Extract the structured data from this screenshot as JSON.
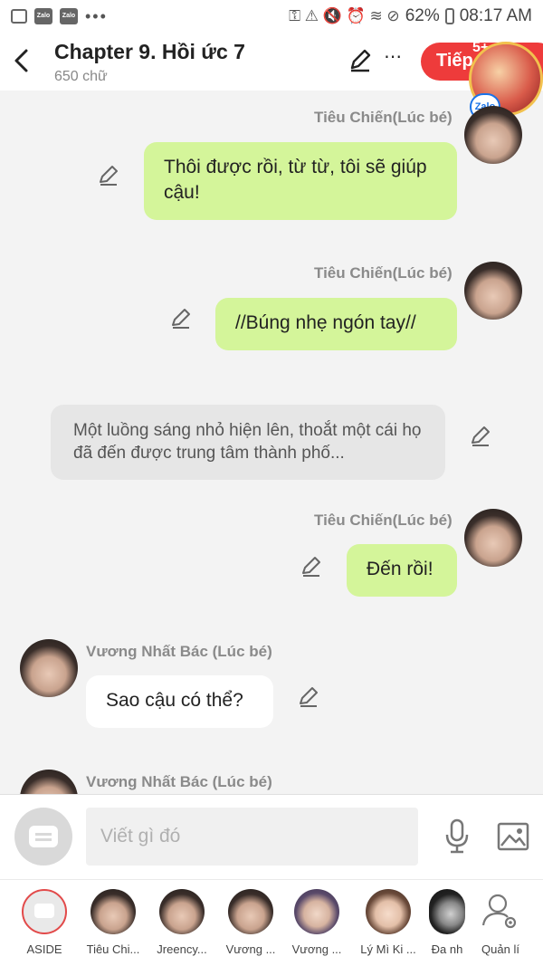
{
  "status_bar": {
    "battery": "62%",
    "time": "08:17 AM",
    "notif_apps": [
      "Zalo",
      "Zalo"
    ],
    "more": "•••"
  },
  "header": {
    "title": "Chapter 9. Hồi ức 7",
    "word_count": "650 chữ",
    "more": "⋯",
    "next_label": "Tiếp",
    "badge": "5+",
    "zalo": "Zalo"
  },
  "messages": [
    {
      "speaker": "Tiêu Chiến(Lúc bé)",
      "text": "Thôi được rồi, từ từ, tôi sẽ giúp cậu!"
    },
    {
      "speaker": "Tiêu Chiến(Lúc bé)",
      "text": "//Búng nhẹ ngón tay//"
    },
    {
      "speaker": "",
      "text": "Một luồng sáng nhỏ hiện lên, thoắt một cái họ đã đến được trung tâm thành phố..."
    },
    {
      "speaker": "Tiêu Chiến(Lúc bé)",
      "text": "Đến rồi!"
    },
    {
      "speaker": "Vương Nhất Bác (Lúc bé)",
      "text": "Sao cậu có thể?"
    },
    {
      "speaker": "Vương Nhất Bác (Lúc bé)",
      "text": ""
    }
  ],
  "composer": {
    "placeholder": "Viết gì đó"
  },
  "characters": [
    {
      "label": "ASIDE"
    },
    {
      "label": "Tiêu Chi..."
    },
    {
      "label": "Jreency..."
    },
    {
      "label": "Vương ..."
    },
    {
      "label": "Vương ..."
    },
    {
      "label": "Lý Mì Ki ..."
    },
    {
      "label": "Đa nh"
    },
    {
      "label": "Quản lí"
    }
  ],
  "colors": {
    "accent_red": "#ee3b3b",
    "bubble_green": "#d4f59a",
    "background": "#f3f3f3"
  },
  "icons": [
    "back-arrow-icon",
    "pencil-icon",
    "more-icon",
    "microphone-icon",
    "image-icon",
    "manage-user-icon",
    "keyboard-icon"
  ]
}
